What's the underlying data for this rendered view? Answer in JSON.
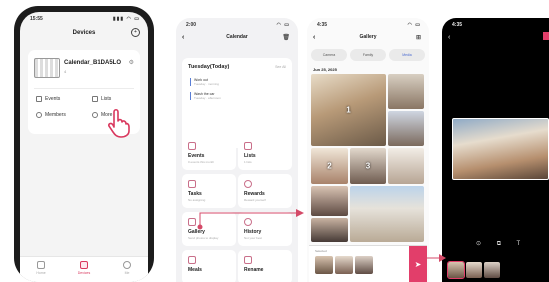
{
  "colors": {
    "accent": "#e23e6a",
    "link": "#4a6ad0",
    "arrow": "#d44a68"
  },
  "devices_screen": {
    "time": "15:55",
    "title": "Devices",
    "device_name": "Calendar_B1DA5LO",
    "device_sub": "4",
    "options": [
      "Events",
      "Lists",
      "Members",
      "More"
    ],
    "tabs": [
      "Home",
      "Devices",
      "Me"
    ]
  },
  "calendar_screen": {
    "time": "2:00",
    "title": "Calendar",
    "today_heading": "Tuesday(Today)",
    "see_all": "See All",
    "events": [
      {
        "title": "Work out",
        "sub": "Tuesday · morning"
      },
      {
        "title": "Wash the car",
        "sub": "Tuesday · afternoon"
      }
    ],
    "tiles": [
      {
        "label": "Events",
        "sub": "0 events this month"
      },
      {
        "label": "Lists",
        "sub": "1 lists"
      },
      {
        "label": "Tasks",
        "sub": "No assigning"
      },
      {
        "label": "Rewards",
        "sub": "Reward yourself"
      },
      {
        "label": "Gallery",
        "sub": "Send photos to display"
      },
      {
        "label": "History",
        "sub": "Not your best"
      },
      {
        "label": "Meals",
        "sub": ""
      },
      {
        "label": "Rename",
        "sub": ""
      }
    ]
  },
  "gallery_screen": {
    "time": "4:35",
    "title": "Gallery",
    "filters": [
      "Camera",
      "Family",
      "Media"
    ],
    "date": "Jun 25, 2025",
    "photo_numbers": [
      "1",
      "2",
      "3"
    ],
    "selected_label": "Selected"
  },
  "editor_screen": {
    "time": "4:35",
    "controls": "⊙ ⧉ T"
  }
}
